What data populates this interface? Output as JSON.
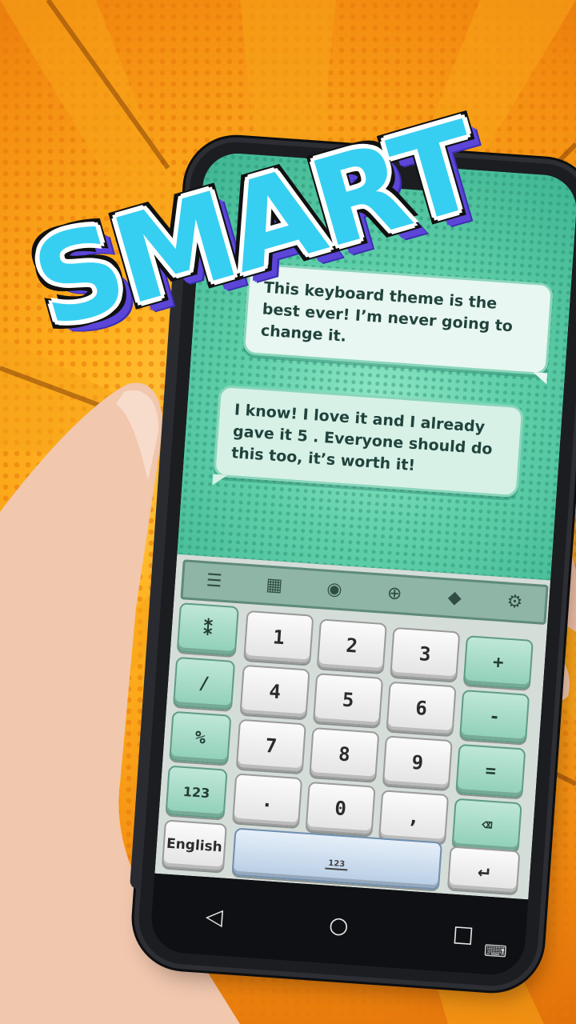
{
  "title": "SMART",
  "messages": {
    "first": "This keyboard theme is the best ever! I’m never going to change it.",
    "second": "I know! I love it and I already gave it 5    . Everyone should do this too, it’s worth it!"
  },
  "toolbar": {
    "icons": [
      "menu-icon",
      "theme-icon",
      "microphone-icon",
      "sticker-icon",
      "diamond-icon",
      "settings-icon"
    ]
  },
  "keys": {
    "row1": {
      "left": "⁑",
      "k1": "1",
      "k2": "2",
      "k3": "3",
      "right": "+"
    },
    "row2": {
      "left": "/",
      "k1": "4",
      "k2": "5",
      "k3": "6",
      "right": "-"
    },
    "row3": {
      "left": "%",
      "k1": "7",
      "k2": "8",
      "k3": "9",
      "right": "="
    },
    "row4": {
      "left": "123",
      "k1": ".",
      "k2": "0",
      "k3": ",",
      "right": "⌫"
    },
    "row5": {
      "left": "English",
      "space": "123",
      "right": "↵"
    }
  },
  "colors": {
    "title": "#37cff1",
    "title_shadow": "#5b46d8",
    "chat_bg": "#5fcfa9",
    "key_accent": "#8fcfb8"
  }
}
